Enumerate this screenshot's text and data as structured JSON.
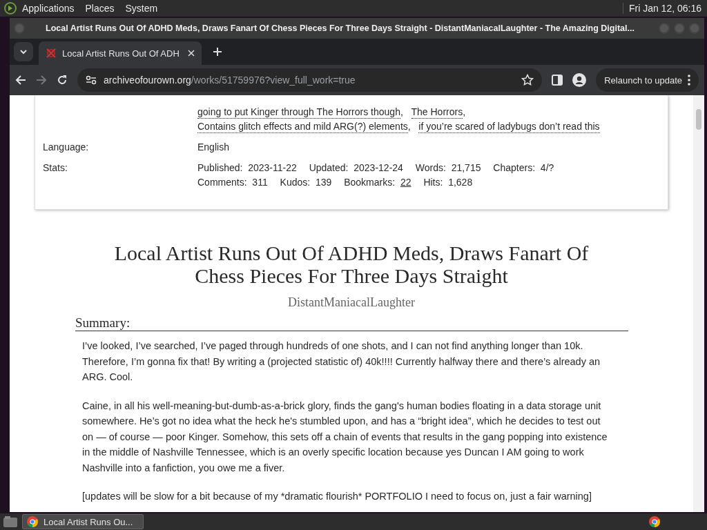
{
  "top_panel": {
    "menus": [
      "Applications",
      "Places",
      "System"
    ],
    "clock": "Fri Jan 12, 06:16"
  },
  "window": {
    "title": "Local Artist Runs Out Of ADHD Meds, Draws Fanart Of Chess Pieces For Three Days Straight - DistantManiacalLaughter - The Amazing Digital..."
  },
  "tabs": [
    {
      "label": "Local Artist Runs Out Of ADH",
      "selected": true
    }
  ],
  "address": {
    "domain": "archiveofourown.org",
    "path": "/works/51759976?view_full_work=true"
  },
  "relaunch_button": "Relaunch to update",
  "meta": {
    "tags": [
      "going to put Kinger through The Horrors though",
      "The Horrors",
      "Contains glitch effects and mild ARG(?) elements",
      "if you’re scared of ladybugs don’t read this"
    ],
    "tag_separator": ",",
    "language": {
      "label": "Language:",
      "value": "English"
    },
    "stats_label": "Stats:",
    "stats": [
      {
        "label": "Published:",
        "value": "2023-11-22",
        "linked": false
      },
      {
        "label": "Updated:",
        "value": "2023-12-24",
        "linked": false
      },
      {
        "label": "Words:",
        "value": "21,715",
        "linked": false
      },
      {
        "label": "Chapters:",
        "value": "4/?",
        "linked": false
      },
      {
        "label": "Comments:",
        "value": "311",
        "linked": false
      },
      {
        "label": "Kudos:",
        "value": "139",
        "linked": false
      },
      {
        "label": "Bookmarks:",
        "value": "22",
        "linked": true
      },
      {
        "label": "Hits:",
        "value": "1,628",
        "linked": false
      }
    ]
  },
  "work": {
    "title": "Local Artist Runs Out Of ADHD Meds, Draws Fanart Of Chess Pieces For Three Days Straight",
    "author": "DistantManiacalLaughter",
    "summary_heading": "Summary:",
    "summary": [
      "I’ve looked, I’ve searched, I’ve paged through hundreds of one shots, and I can not find anything longer than 10k. Therefore, I’m gonna fix that! By writing a (projected statistic of) 40k!!!! Currently halfway there and there’s already an ARG. Cool.",
      "Caine, in all his well-meaning-but-dumb-as-a-brick glory, finds the gang's human bodies floating in a data storage unit somewhere. He’s got no idea what the heck he's stumbled upon, and has a “bright idea”, which he decides to test out on — of course — poor Kinger. Somehow, this sets off a chain of events that results in the gang popping into existence in the middle of Nashville Tennessee, which is an overly specific location because yes Duncan I AM going to work Nashville into a fanfiction, you owe me a fiver.",
      "[updates will be slow for a bit because of my *dramatic flourish* PORTFOLIO I need to focus on, just a fair warning]"
    ]
  },
  "taskbar": {
    "tasks": [
      {
        "label": "Local Artist Runs Ou...",
        "selected": true
      }
    ]
  }
}
